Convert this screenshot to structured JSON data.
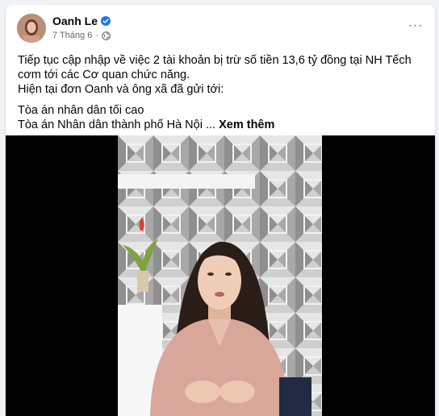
{
  "post": {
    "author": "Oanh Le",
    "date": "7 Tháng 6",
    "separator": "·",
    "more_label": "···",
    "lines": [
      "Tiếp tục cập nhập về việc 2 tài khoản bị trừ số tiền 13,6 tỷ đồng tại NH Tếch cơm tới các Cơ quan chức năng.",
      "Hiện tại đơn Oanh và ông xã đã gửi tới:",
      "Tòa án nhân dân tối cao",
      "Tòa án Nhân dân thành phố Hà Nội ..."
    ],
    "see_more": "Xem thêm"
  },
  "colors": {
    "verified": "#1877f2",
    "secondary_text": "#65676b",
    "page_bg": "#f0f2f5"
  },
  "icons": {
    "verified": "verified-badge-icon",
    "privacy": "globe-icon",
    "more": "more-horizontal-icon"
  }
}
